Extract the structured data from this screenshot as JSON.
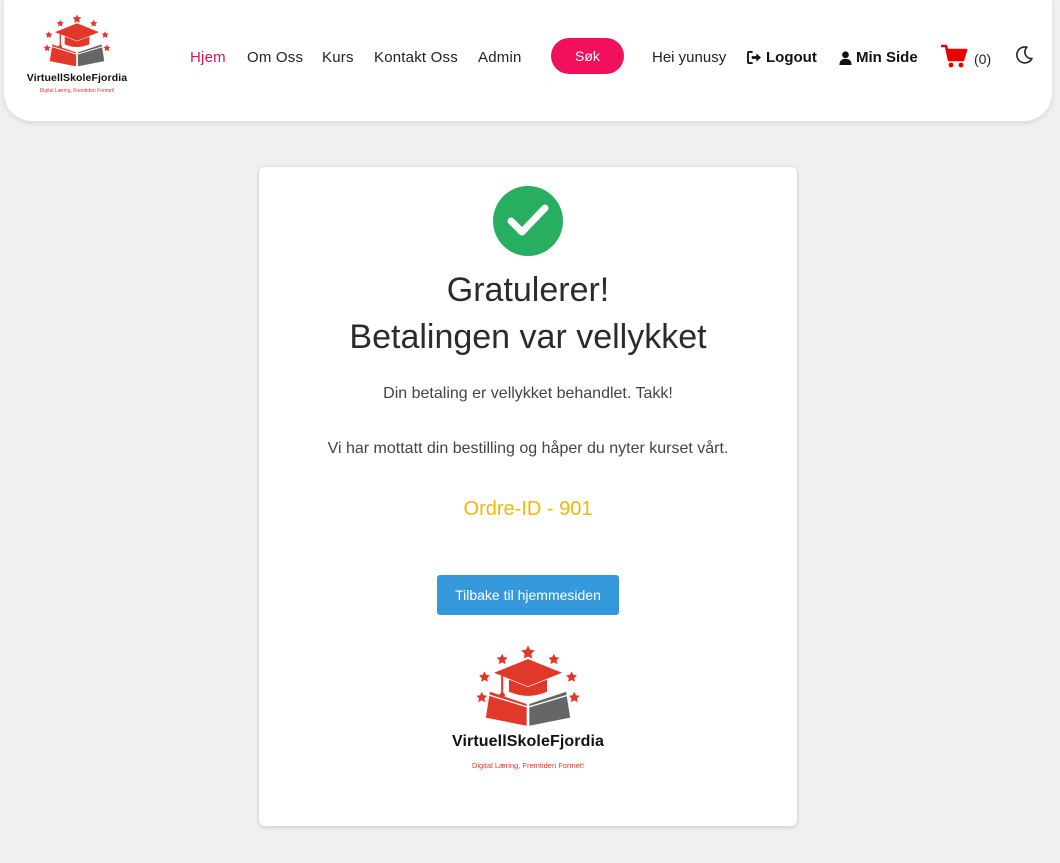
{
  "brand": {
    "name": "VirtuellSkoleFjordia",
    "tagline": "Digital Læring, Fremtiden Formet!",
    "colors": {
      "red": "#e0392b",
      "gray": "#666666"
    }
  },
  "nav": {
    "links": [
      "Hjem",
      "Om Oss",
      "Kurs",
      "Kontakt Oss",
      "Admin"
    ],
    "active_link": "Hjem",
    "search_label": "Søk",
    "greeting": "Hei yunusy",
    "logout_label": "Logout",
    "my_page_label": "Min Side",
    "cart_count": "(0)",
    "icons": {
      "logout": "sign-out-icon",
      "user": "user-icon",
      "cart": "shopping-cart-icon",
      "theme": "moon-icon"
    },
    "accent_color": "#f20f5c"
  },
  "confirmation": {
    "icon": "check-circle-icon",
    "title_line1": "Gratulerer!",
    "title_line2": "Betalingen var vellykket",
    "message1": "Din betaling er vellykket behandlet. Takk!",
    "message2": "Vi har mottatt din bestilling og håper du nyter kurset vårt.",
    "order_id": "Ordre-ID - 901",
    "home_button": "Tilbake til hjemmesiden",
    "colors": {
      "success": "#27ae60",
      "order_id": "#f2b705",
      "button": "#3498db"
    }
  }
}
